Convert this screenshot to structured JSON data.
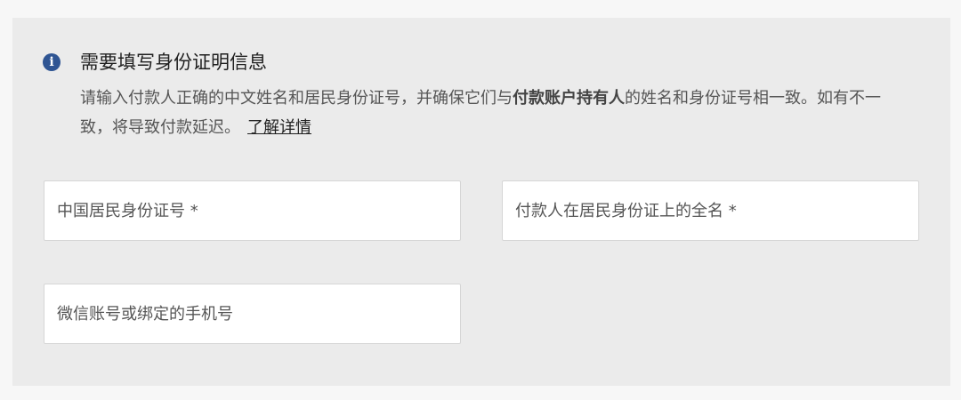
{
  "notice": {
    "icon": "info-icon",
    "icon_glyph": "i",
    "accent_color": "#2f5593",
    "title": "需要填写身份证明信息",
    "body_part1": "请输入付款人正确的中文姓名和居民身份证号，并确保它们与",
    "body_bold": "付款账户持有人",
    "body_part2": "的姓名和身份证号相一致。如有不一致，将导致付款延迟。",
    "learn_more": "了解详情"
  },
  "form": {
    "id_number_placeholder": "中国居民身份证号 *",
    "full_name_placeholder": "付款人在居民身份证上的全名 *",
    "wechat_placeholder": "微信账号或绑定的手机号"
  }
}
